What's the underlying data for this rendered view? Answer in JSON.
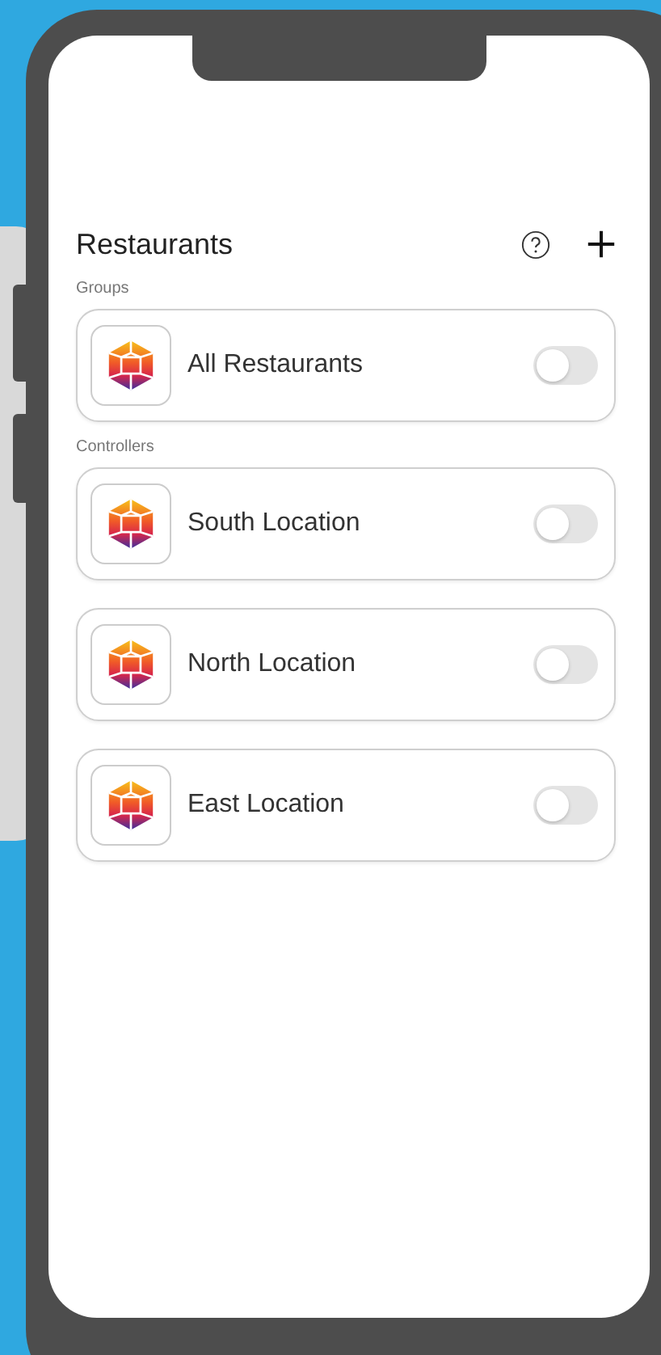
{
  "header": {
    "title": "Restaurants"
  },
  "sections": [
    {
      "label": "Groups",
      "items": [
        {
          "name": "All Restaurants",
          "on": false
        }
      ]
    },
    {
      "label": "Controllers",
      "items": [
        {
          "name": "South Location",
          "on": false
        },
        {
          "name": "North Location",
          "on": false
        },
        {
          "name": "East Location",
          "on": false
        }
      ]
    }
  ]
}
